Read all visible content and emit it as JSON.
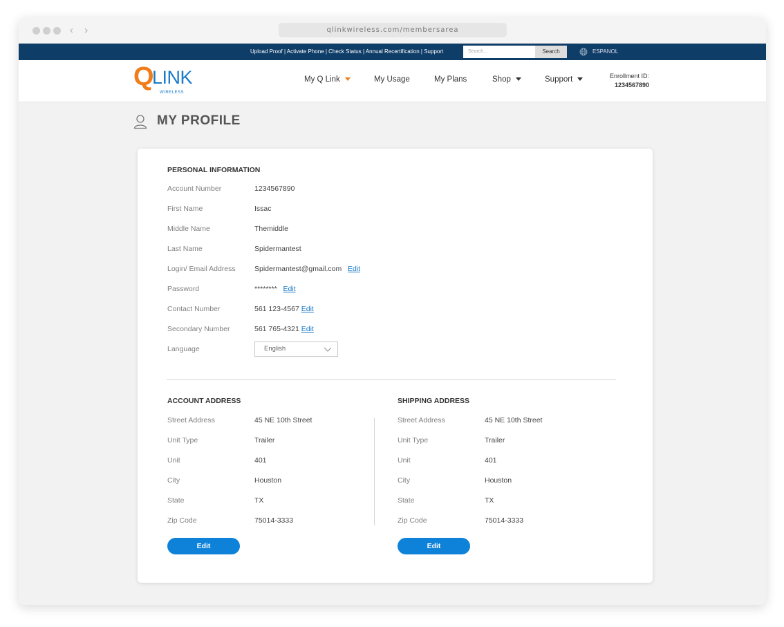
{
  "browser": {
    "url": "qlinkwireless.com/membersarea",
    "back_glyph": "‹",
    "forward_glyph": "›"
  },
  "topbar": {
    "links": [
      {
        "label": "Upload Proof"
      },
      {
        "label": "Activate Phone"
      },
      {
        "label": "Check Status"
      },
      {
        "label": "Annual Recertification"
      },
      {
        "label": "Support"
      }
    ],
    "separator": "|",
    "search_placeholder": "Search...",
    "search_button": "Search",
    "language_link": "ESPANOL"
  },
  "header": {
    "logo_text": "QLINK",
    "logo_sub": "W I R E L E S S",
    "nav": [
      {
        "label": "My Q Link"
      },
      {
        "label": "My Usage"
      },
      {
        "label": "My Plans"
      },
      {
        "label": "Shop"
      },
      {
        "label": "Support"
      }
    ],
    "enrollment_label": "Enrollment ID:",
    "enrollment_id": "1234567890"
  },
  "page": {
    "title": "MY PROFILE"
  },
  "personal": {
    "title": "PERSONAL INFORMATION",
    "rows": [
      {
        "label": "Account Number",
        "value": "1234567890"
      },
      {
        "label": "First Name",
        "value": "Issac"
      },
      {
        "label": "Middle Name",
        "value": "Themiddle"
      },
      {
        "label": "Last Name",
        "value": "Spidermantest"
      },
      {
        "label": "Login/ Email Address",
        "value": "Spidermantest@gmail.com",
        "edit": "Edit"
      },
      {
        "label": "Password",
        "value": "********",
        "edit": "Edit"
      },
      {
        "label": "Contact Number",
        "value": "561 123-4567",
        "edit": "Edit"
      },
      {
        "label": "Secondary Number",
        "value": "561 765-4321",
        "edit": "Edit"
      }
    ],
    "language_label": "Language",
    "language_value": "English"
  },
  "account_address": {
    "title": "ACCOUNT ADDRESS",
    "rows": [
      {
        "label": "Street Address",
        "value": "45 NE 10th Street"
      },
      {
        "label": "Unit Type",
        "value": "Trailer"
      },
      {
        "label": "Unit",
        "value": "401"
      },
      {
        "label": "City",
        "value": "Houston"
      },
      {
        "label": "State",
        "value": "TX"
      },
      {
        "label": "Zip Code",
        "value": "75014-3333"
      }
    ],
    "button": "Edit"
  },
  "shipping_address": {
    "title": "SHIPPING ADDRESS",
    "rows": [
      {
        "label": "Street Address",
        "value": "45 NE 10th Street"
      },
      {
        "label": "Unit Type",
        "value": "Trailer"
      },
      {
        "label": "Unit",
        "value": "401"
      },
      {
        "label": "City",
        "value": "Houston"
      },
      {
        "label": "State",
        "value": "TX"
      },
      {
        "label": "Zip Code",
        "value": "75014-3333"
      }
    ],
    "button": "Edit"
  },
  "colors": {
    "topbar": "#0e3d68",
    "logo_orange": "#f07c1a",
    "logo_blue": "#1a7bc9",
    "button_blue": "#0d82d8",
    "link_blue": "#1a7bc9"
  },
  "icons": {
    "user": "user-icon",
    "globe": "globe-icon",
    "dropdown": "chevron-down-icon"
  }
}
